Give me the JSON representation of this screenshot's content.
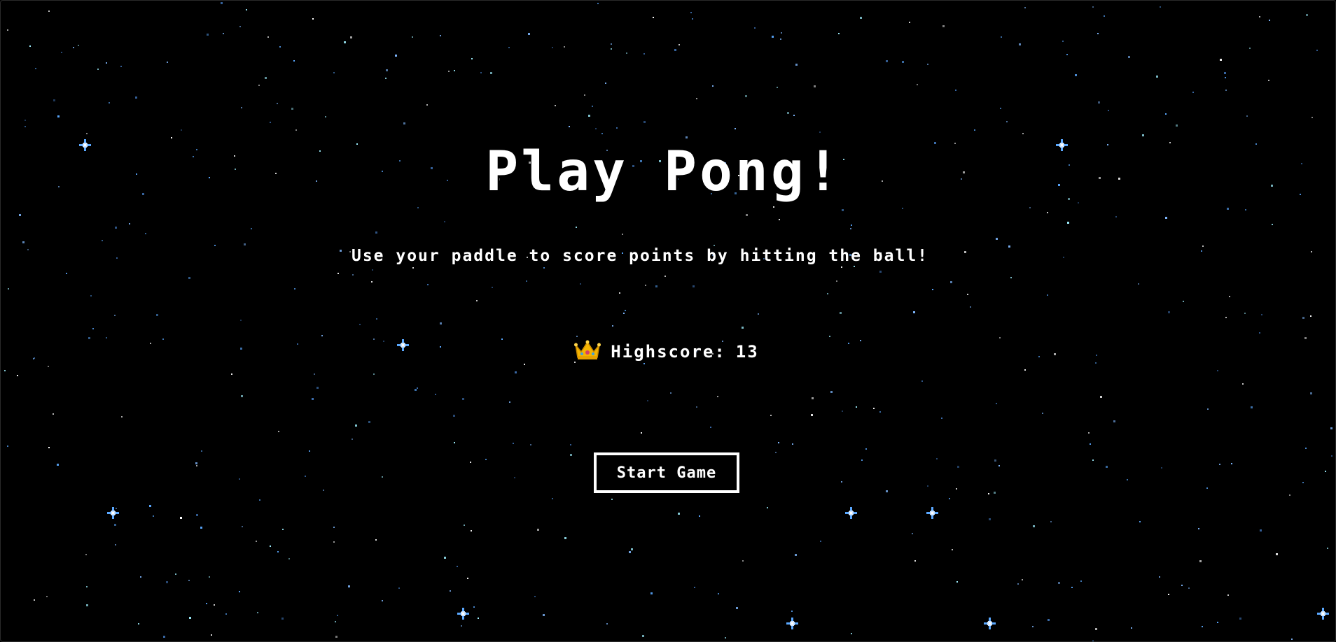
{
  "game": {
    "title": "Play Pong!",
    "subtitle": "Use your paddle to score points by hitting the ball!",
    "highscore_label": "Highscore:",
    "highscore_value": "13",
    "start_button_label": "Start Game"
  },
  "icons": {
    "highscore_icon": "crown-icon"
  },
  "colors": {
    "background": "#000000",
    "text": "#ffffff",
    "star_white": "#ffffff",
    "star_blue": "#5aa8ff",
    "star_cyan": "#9ef0ff",
    "crown_gold": "#f5b400"
  }
}
